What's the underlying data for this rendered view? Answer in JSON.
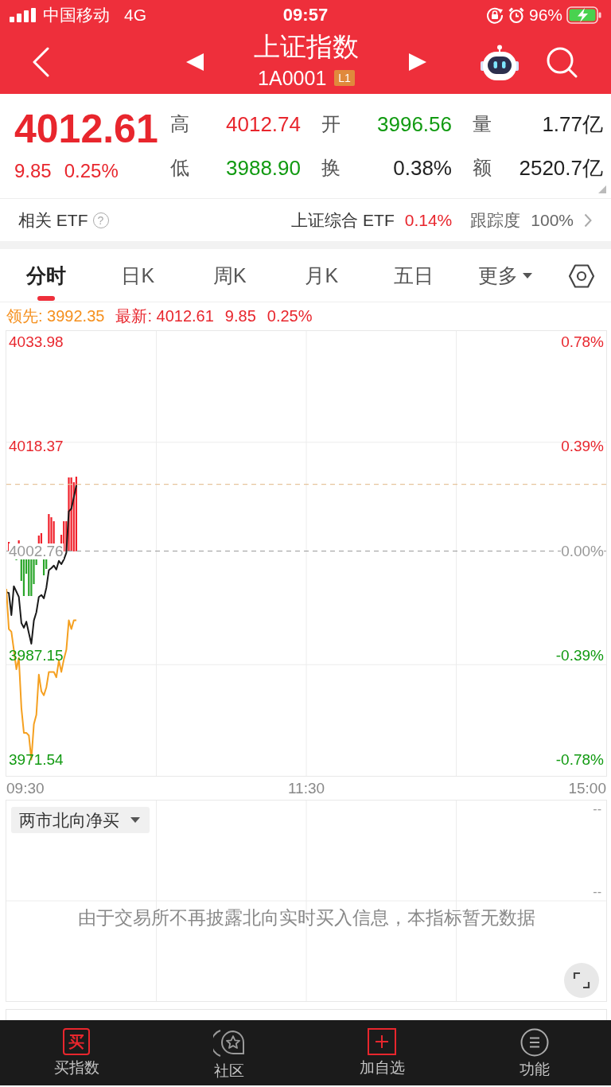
{
  "status_bar": {
    "carrier": "中国移动",
    "network": "4G",
    "time": "09:57",
    "battery": "96%"
  },
  "header": {
    "title": "上证指数",
    "code": "1A0001",
    "badge": "L1"
  },
  "quote": {
    "price": "4012.61",
    "change": "9.85",
    "change_percent": "0.25%",
    "color": "#e8262d",
    "stats": [
      {
        "label": "高",
        "value": "4012.74",
        "color": "#e8262d"
      },
      {
        "label": "开",
        "value": "3996.56",
        "color": "#119a11"
      },
      {
        "label": "量",
        "value": "1.77亿",
        "color": "#222222"
      },
      {
        "label": "低",
        "value": "3988.90",
        "color": "#119a11"
      },
      {
        "label": "换",
        "value": "0.38%",
        "color": "#222222"
      },
      {
        "label": "额",
        "value": "2520.7亿",
        "color": "#222222"
      }
    ]
  },
  "related_etf": {
    "label": "相关 ETF",
    "help": "?",
    "name": "上证综合 ETF",
    "change": "0.14%",
    "color": "#e8262d",
    "tracking_label": "跟踪度",
    "tracking_value": "100%"
  },
  "tabs": [
    {
      "label": "分时",
      "selected": true,
      "kind": "tab"
    },
    {
      "label": "日K",
      "selected": false,
      "kind": "tab"
    },
    {
      "label": "周K",
      "selected": false,
      "kind": "tab"
    },
    {
      "label": "月K",
      "selected": false,
      "kind": "tab"
    },
    {
      "label": "五日",
      "selected": false,
      "kind": "tab"
    },
    {
      "label": "更多",
      "selected": false,
      "kind": "dropdown"
    }
  ],
  "chart": {
    "legend": [
      {
        "text": "领先: 3992.35",
        "color": "#f5901e"
      },
      {
        "text": "最新: 4012.61",
        "color": "#e8262d"
      },
      {
        "text": "9.85",
        "color": "#e8262d"
      },
      {
        "text": "0.25%",
        "color": "#e8262d"
      }
    ],
    "chart_data": {
      "type": "line",
      "categories": [
        null,
        null,
        null,
        null,
        null,
        null,
        null,
        null,
        null,
        null,
        null,
        null,
        null,
        null,
        null,
        null,
        null,
        null,
        null,
        null,
        null,
        null,
        null,
        null,
        null,
        null,
        null,
        null,
        null,
        null,
        null,
        null,
        null,
        null,
        null,
        null,
        null,
        null,
        null,
        null,
        null,
        null,
        null,
        null,
        null,
        null,
        null,
        null,
        null,
        null,
        null,
        null,
        null,
        null,
        null,
        null,
        null,
        null,
        null,
        null,
        null,
        null,
        null,
        null,
        null,
        null,
        null,
        null,
        null,
        null,
        null,
        null,
        null,
        null,
        null,
        null,
        null,
        null,
        null,
        null,
        null,
        null,
        null,
        null,
        null,
        null,
        null,
        null,
        null,
        null,
        null,
        null,
        null,
        null,
        null,
        null,
        null,
        null,
        null,
        null,
        null,
        null,
        null,
        null,
        null,
        null,
        null,
        null,
        null,
        null,
        null,
        null,
        null,
        null,
        null,
        null,
        null,
        null,
        null,
        null,
        null,
        null,
        null,
        null,
        null,
        null,
        null,
        null,
        null,
        null,
        null,
        null,
        null,
        null,
        null,
        null,
        null,
        null,
        null,
        null,
        null,
        null,
        null,
        null,
        null,
        null,
        null,
        null,
        null,
        null,
        null,
        null,
        null,
        null,
        null,
        null,
        null,
        null,
        null,
        null,
        null,
        null,
        null,
        null,
        null,
        null,
        null,
        null,
        null,
        null,
        null,
        null,
        null,
        null,
        null,
        null,
        null,
        null,
        null,
        null,
        null,
        null,
        null,
        null,
        null,
        null,
        null,
        null,
        null,
        null,
        null,
        null,
        null,
        null,
        null,
        null,
        null,
        null,
        null,
        null,
        null,
        null,
        null,
        null,
        null,
        null,
        null,
        null,
        null,
        null,
        null,
        null,
        null,
        null,
        null,
        null,
        null,
        null,
        null,
        null,
        null,
        null,
        null,
        null,
        null,
        null,
        null,
        null,
        null,
        null,
        null,
        null,
        null,
        null,
        null,
        null,
        null,
        null,
        null,
        null,
        null
      ],
      "series": [
        {
          "color": "#1a1a1a",
          "values": [
            3996.6,
            3996.5,
            3993.2,
            3997.5,
            3996.7,
            3995.9,
            3992,
            3991.3,
            3992.2,
            3990.5,
            3988.9,
            3992.4,
            3993.6,
            3995.9,
            3996.2,
            3995.7,
            3997.3,
            3999.9,
            4000.2,
            4000.6,
            4000,
            4001.3,
            4000.8,
            4001.5,
            4002.5,
            4008.7,
            4009.1,
            4010.8,
            4012.6,
            null,
            null,
            null,
            null,
            null,
            null,
            null,
            null,
            null,
            null,
            null,
            null,
            null,
            null,
            null,
            null,
            null,
            null,
            null,
            null,
            null,
            null,
            null,
            null,
            null,
            null,
            null,
            null,
            null,
            null,
            null,
            null,
            null,
            null,
            null,
            null,
            null,
            null,
            null,
            null,
            null,
            null,
            null,
            null,
            null,
            null,
            null,
            null,
            null,
            null,
            null,
            null,
            null,
            null,
            null,
            null,
            null,
            null,
            null,
            null,
            null,
            null,
            null,
            null,
            null,
            null,
            null,
            null,
            null,
            null,
            null,
            null,
            null,
            null,
            null,
            null,
            null,
            null,
            null,
            null,
            null,
            null,
            null,
            null,
            null,
            null,
            null,
            null,
            null,
            null,
            null,
            null,
            null,
            null,
            null,
            null,
            null,
            null,
            null,
            null,
            null,
            null,
            null,
            null,
            null,
            null,
            null,
            null,
            null,
            null,
            null,
            null,
            null,
            null,
            null,
            null,
            null,
            null,
            null,
            null,
            null,
            null,
            null,
            null,
            null,
            null,
            null,
            null,
            null,
            null,
            null,
            null,
            null,
            null,
            null,
            null,
            null,
            null,
            null,
            null,
            null,
            null,
            null,
            null,
            null,
            null,
            null,
            null,
            null,
            null,
            null,
            null,
            null,
            null,
            null,
            null,
            null,
            null,
            null,
            null,
            null,
            null,
            null,
            null,
            null,
            null,
            null,
            null,
            null,
            null,
            null,
            null,
            null,
            null,
            null,
            null,
            null,
            null,
            null,
            null,
            null,
            null,
            null,
            null,
            null,
            null,
            null,
            null,
            null,
            null,
            null,
            null,
            null,
            null,
            null,
            null,
            null,
            null,
            null,
            null,
            null,
            null,
            null,
            null,
            null,
            null,
            null,
            null,
            null,
            null,
            null,
            null
          ]
        },
        {
          "color": "#f5a020",
          "values": [
            3997.1,
            3991.1,
            3990.7,
            3988,
            3985.1,
            3986.8,
            3979.3,
            3975.6,
            3975.6,
            3975.2,
            3971.6,
            3976.9,
            3978.3,
            3984.3,
            3981.8,
            3981.2,
            3982.4,
            3984.7,
            3984.7,
            3984.7,
            3983.9,
            3986.4,
            3984.7,
            3986.6,
            3988,
            3992.4,
            3991.1,
            3992.4,
            3992.4,
            null,
            null,
            null,
            null,
            null,
            null,
            null,
            null,
            null,
            null,
            null,
            null,
            null,
            null,
            null,
            null,
            null,
            null,
            null,
            null,
            null,
            null,
            null,
            null,
            null,
            null,
            null,
            null,
            null,
            null,
            null,
            null,
            null,
            null,
            null,
            null,
            null,
            null,
            null,
            null,
            null,
            null,
            null,
            null,
            null,
            null,
            null,
            null,
            null,
            null,
            null,
            null,
            null,
            null,
            null,
            null,
            null,
            null,
            null,
            null,
            null,
            null,
            null,
            null,
            null,
            null,
            null,
            null,
            null,
            null,
            null,
            null,
            null,
            null,
            null,
            null,
            null,
            null,
            null,
            null,
            null,
            null,
            null,
            null,
            null,
            null,
            null,
            null,
            null,
            null,
            null,
            null,
            null,
            null,
            null,
            null,
            null,
            null,
            null,
            null,
            null,
            null,
            null,
            null,
            null,
            null,
            null,
            null,
            null,
            null,
            null,
            null,
            null,
            null,
            null,
            null,
            null,
            null,
            null,
            null,
            null,
            null,
            null,
            null,
            null,
            null,
            null,
            null,
            null,
            null,
            null,
            null,
            null,
            null,
            null,
            null,
            null,
            null,
            null,
            null,
            null,
            null,
            null,
            null,
            null,
            null,
            null,
            null,
            null,
            null,
            null,
            null,
            null,
            null,
            null,
            null,
            null,
            null,
            null,
            null,
            null,
            null,
            null,
            null,
            null,
            null,
            null,
            null,
            null,
            null,
            null,
            null,
            null,
            null,
            null,
            null,
            null,
            null,
            null,
            null,
            null,
            null,
            null,
            null,
            null,
            null,
            null,
            null,
            null,
            null,
            null,
            null,
            null,
            null,
            null,
            null,
            null,
            null,
            null,
            null,
            null,
            null,
            null,
            null,
            null,
            null,
            null,
            null,
            null,
            null,
            null,
            null
          ]
        }
      ],
      "ylim": [
        3969.16,
        4035.65
      ],
      "yticks": [
        {
          "value": 3971.54,
          "label": "3971.54"
        },
        {
          "value": 3987.15,
          "label": "3987.15"
        },
        {
          "value": 4002.76,
          "label": "4002.76"
        },
        {
          "value": 4018.37,
          "label": "4018.37"
        },
        {
          "value": 4033.98,
          "label": "4033.98"
        }
      ],
      "ref_lines": [
        {
          "axis": "y",
          "value": 4002.76,
          "color": "#9a9a9a"
        },
        {
          "axis": "y",
          "value": 4012.74,
          "color": "#e6c49c"
        }
      ]
    },
    "right_labels": [
      {
        "text": "0.78%",
        "color": "#e8262d"
      },
      {
        "text": "0.39%",
        "color": "#e8262d"
      },
      {
        "text": "0.00%",
        "color": "#999999"
      },
      {
        "text": "-0.39%",
        "color": "#119a11"
      },
      {
        "text": "-0.78%",
        "color": "#119a11"
      }
    ],
    "time_labels": [
      "09:30",
      "11:30",
      "15:00"
    ]
  },
  "indicator": {
    "selector": "两市北向净买",
    "axis_labels": [
      "--",
      "--"
    ],
    "message": "由于交易所不再披露北向实时买入信息，本指标暂无数据"
  },
  "bottom_nav": [
    {
      "label": "买指数",
      "kind": "buy",
      "icon_text": "买"
    },
    {
      "label": "社区",
      "kind": "community"
    },
    {
      "label": "加自选",
      "kind": "add"
    },
    {
      "label": "功能",
      "kind": "functions"
    }
  ]
}
